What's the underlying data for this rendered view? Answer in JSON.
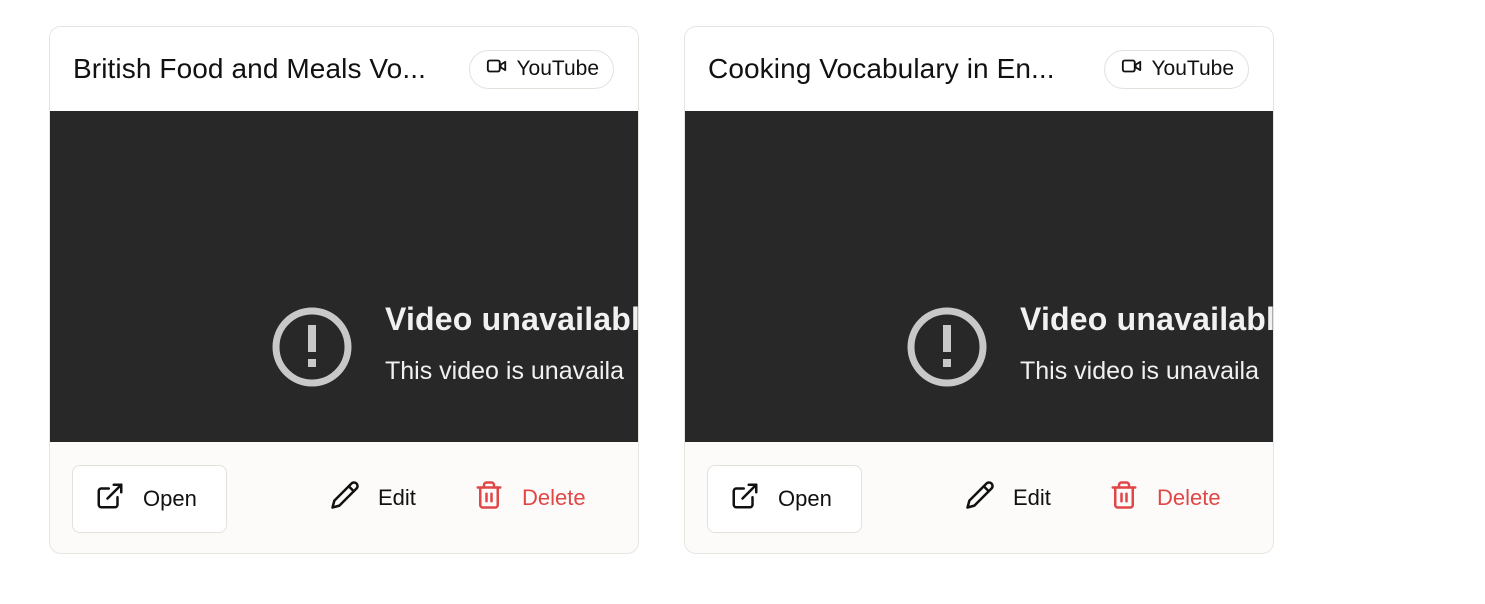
{
  "cards": [
    {
      "title": "British Food and Meals Vo...",
      "badge": "YouTube",
      "video_error_title": "Video unavailable",
      "video_error_subtitle": "This video is unavaila",
      "actions": {
        "open": "Open",
        "edit": "Edit",
        "delete": "Delete"
      }
    },
    {
      "title": "Cooking Vocabulary in En...",
      "badge": "YouTube",
      "video_error_title": "Video unavailable",
      "video_error_subtitle": "This video is unavaila",
      "actions": {
        "open": "Open",
        "edit": "Edit",
        "delete": "Delete"
      }
    }
  ],
  "icons": {
    "badge": "video-camera-icon",
    "error": "alert-circle-icon",
    "open": "external-link-icon",
    "edit": "pencil-icon",
    "delete": "trash-icon"
  },
  "colors": {
    "video_bg": "#282828",
    "delete": "#e04848",
    "footer_bg": "#fcfbf9"
  }
}
